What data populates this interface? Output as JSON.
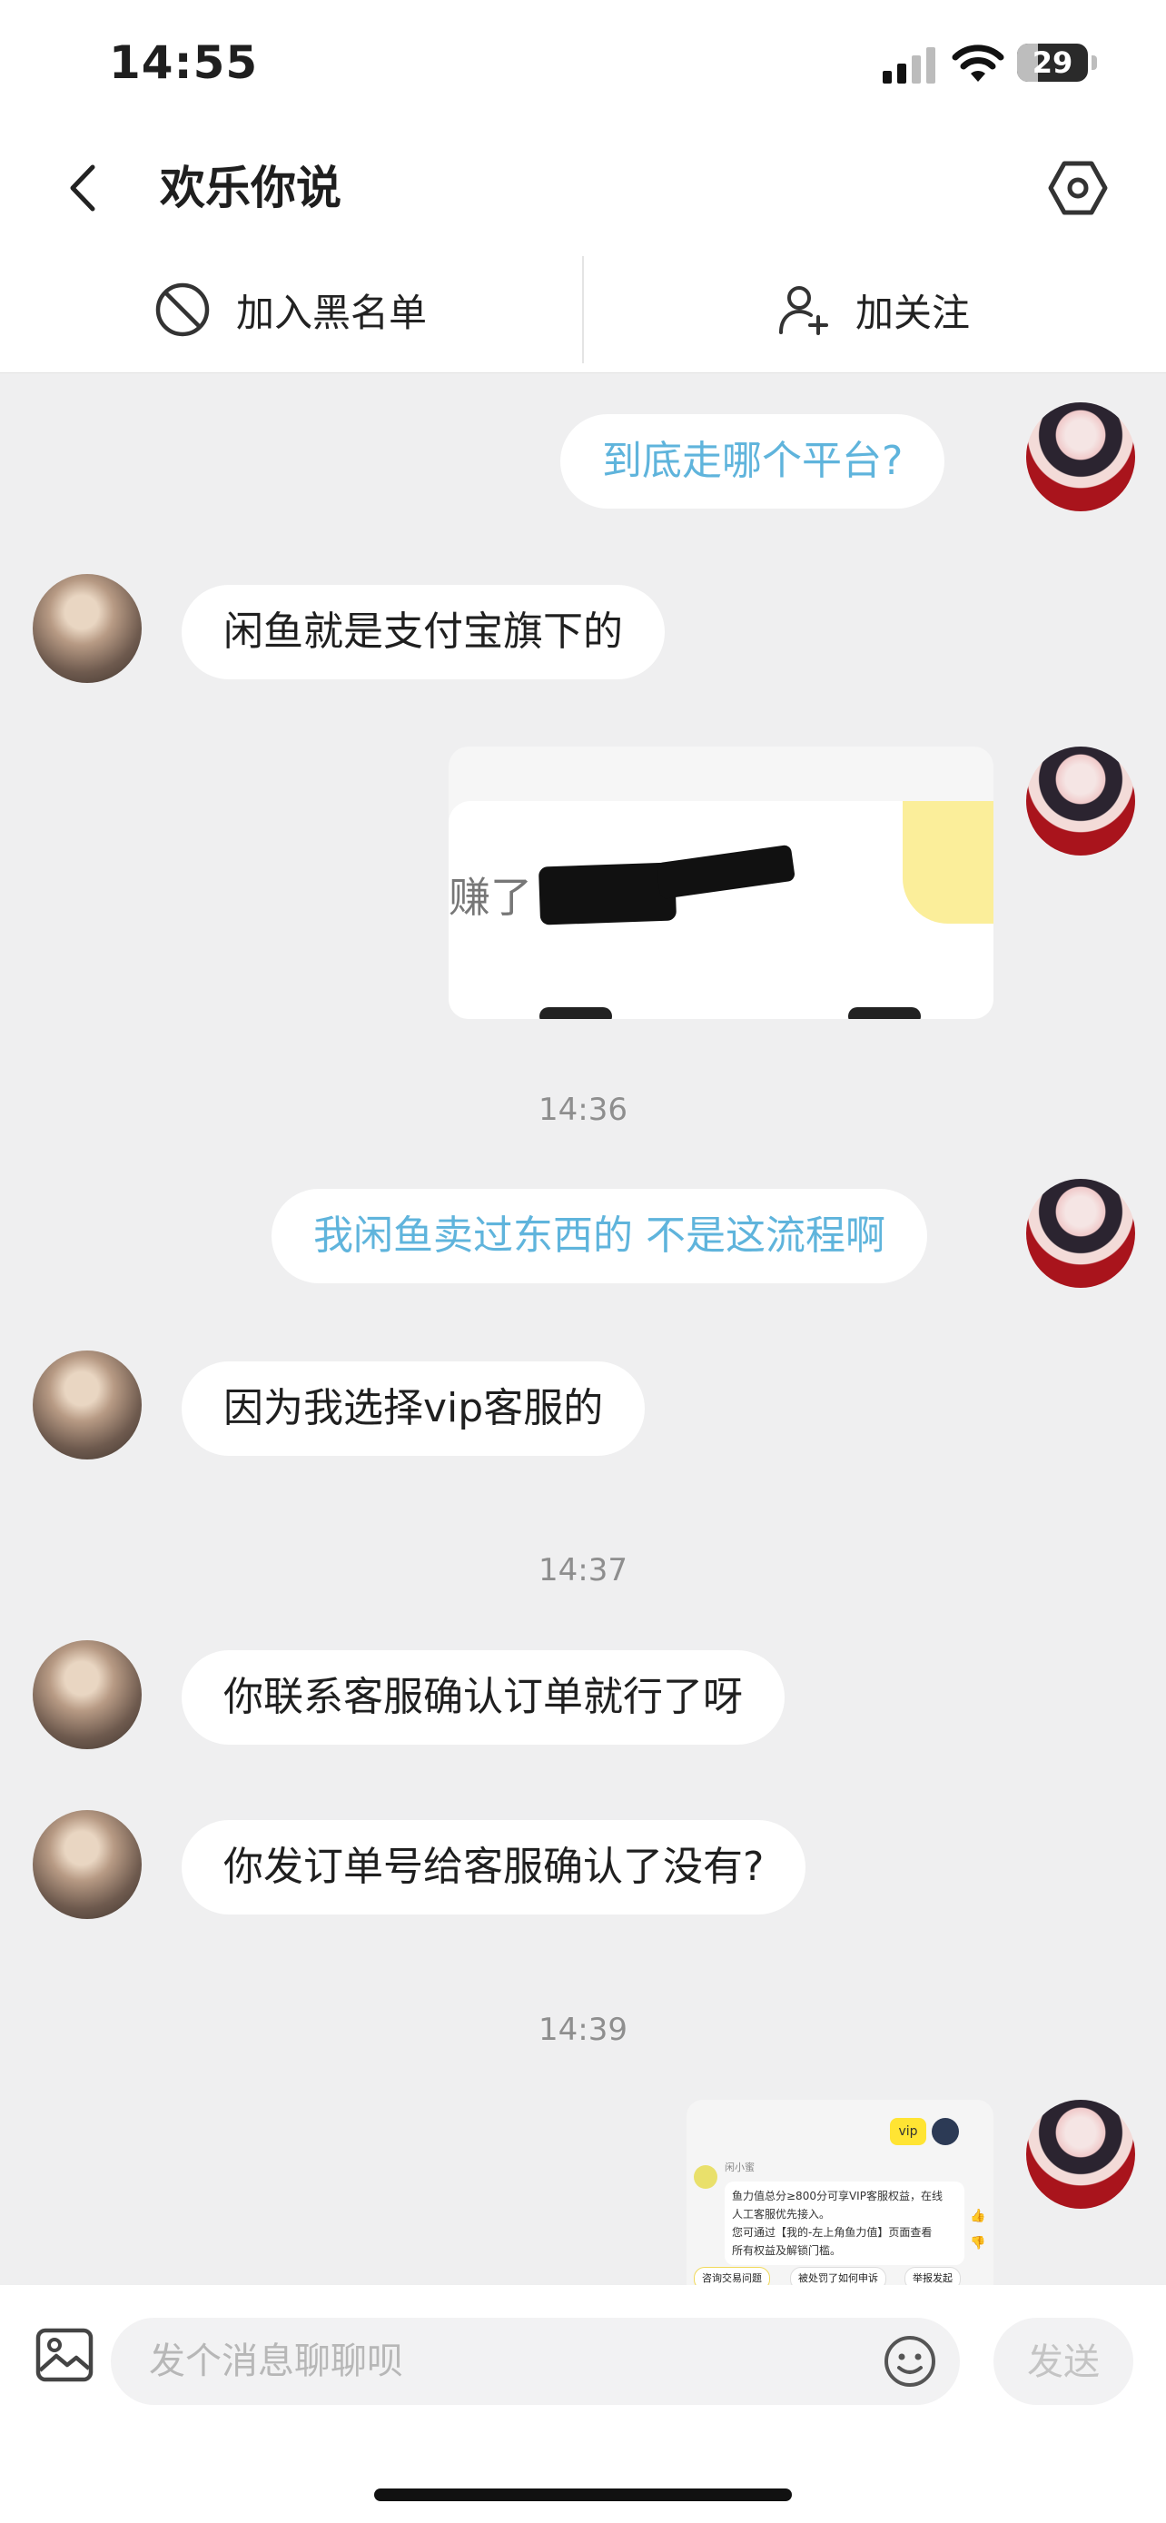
{
  "status_bar": {
    "time": "14:55",
    "battery_level": "29",
    "battery_fraction": 0.29
  },
  "header": {
    "title": "欢乐你说"
  },
  "actions": {
    "blacklist_label": "加入黑名单",
    "follow_label": "加关注"
  },
  "messages": [
    {
      "from": "me",
      "text": "到底走哪个平台?"
    },
    {
      "from": "them",
      "text": "闲鱼就是支付宝旗下的"
    },
    {
      "from": "me",
      "type": "image",
      "partial_text": "赚了"
    },
    {
      "type": "timestamp",
      "text": "14:36"
    },
    {
      "from": "me",
      "text": "我闲鱼卖过东西的 不是这流程啊"
    },
    {
      "from": "them",
      "text": "因为我选择vip客服的"
    },
    {
      "type": "timestamp",
      "text": "14:37"
    },
    {
      "from": "them",
      "text": "你联系客服确认订单就行了呀"
    },
    {
      "from": "them",
      "text": "你发订单号给客服确认了没有?"
    },
    {
      "type": "timestamp",
      "text": "14:39"
    },
    {
      "from": "me",
      "type": "image",
      "screenshot": {
        "vip_badge": "vip",
        "sender": "闲小蜜",
        "line1": "鱼力值总分≥800分可享VIP客服权益，在线",
        "line2": "人工客服优先接入。",
        "line3": "您可通过【我的-左上角鱼力值】页面查看",
        "line4": "所有权益及解锁门槛。",
        "chip1": "咨询交易问题",
        "chip2": "被处罚了如何申诉",
        "chip3": "举报发起"
      }
    }
  ],
  "composer": {
    "placeholder": "发个消息聊聊呗",
    "value": "",
    "send_label": "发送"
  },
  "colors": {
    "my_text": "#5fb4dc",
    "background": "#efeff0",
    "bubble": "#ffffff"
  }
}
